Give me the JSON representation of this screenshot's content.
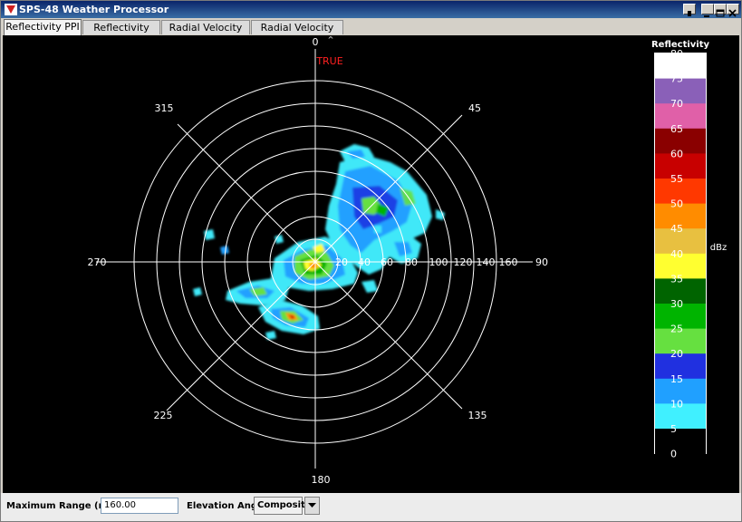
{
  "window": {
    "title": "SPS-48 Weather Processor"
  },
  "tabs": [
    {
      "label": "Reflectivity PPI",
      "active": true
    },
    {
      "label": "Reflectivity RHI",
      "active": false
    },
    {
      "label": "Radial Velocity PPI",
      "active": false
    },
    {
      "label": "Radial Velocity RHI",
      "active": false
    }
  ],
  "ppi": {
    "north_reference": "TRUE",
    "bearing_labels": {
      "n": "0",
      "ne": "45",
      "e": "90",
      "se": "135",
      "s": "180",
      "sw": "225",
      "w": "270",
      "nw": "315"
    },
    "range_rings_nm": [
      "20",
      "40",
      "60",
      "80",
      "100",
      "120",
      "140",
      "160"
    ],
    "colors": {
      "background": "#000000",
      "grid": "#ffffff",
      "north_label": "#ff2020"
    }
  },
  "legend": {
    "title": "Reflectivity",
    "unit": "dBz",
    "levels": [
      {
        "value": "80",
        "color": "#ffffff"
      },
      {
        "value": "75",
        "color": "#8a60b8"
      },
      {
        "value": "70",
        "color": "#e060a8"
      },
      {
        "value": "65",
        "color": "#8a0000"
      },
      {
        "value": "60",
        "color": "#c80000"
      },
      {
        "value": "55",
        "color": "#ff3800"
      },
      {
        "value": "50",
        "color": "#ff8c00"
      },
      {
        "value": "45",
        "color": "#e8c040"
      },
      {
        "value": "40",
        "color": "#ffff30"
      },
      {
        "value": "35",
        "color": "#006400"
      },
      {
        "value": "30",
        "color": "#00b400"
      },
      {
        "value": "25",
        "color": "#66e040"
      },
      {
        "value": "20",
        "color": "#2030e0"
      },
      {
        "value": "15",
        "color": "#20a0ff"
      },
      {
        "value": "10",
        "color": "#40f0ff"
      },
      {
        "value": "5",
        "color": "#000000"
      },
      {
        "value": "0",
        "color": ""
      }
    ]
  },
  "controls": {
    "max_range_label": "Maximum Range (nm)",
    "max_range_value": "160.00",
    "elevation_label": "Elevation Angle",
    "elevation_value": "Composite"
  }
}
